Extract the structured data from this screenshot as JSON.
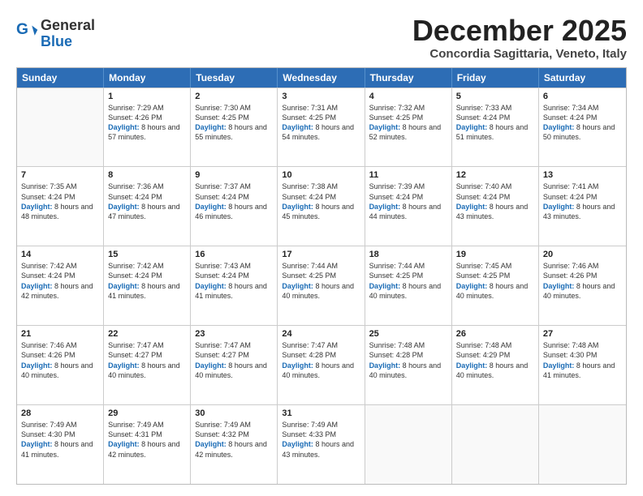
{
  "header": {
    "logo_general": "General",
    "logo_blue": "Blue",
    "month_title": "December 2025",
    "subtitle": "Concordia Sagittaria, Veneto, Italy"
  },
  "weekdays": [
    "Sunday",
    "Monday",
    "Tuesday",
    "Wednesday",
    "Thursday",
    "Friday",
    "Saturday"
  ],
  "rows": [
    [
      {
        "day": "",
        "sunrise": "",
        "sunset": "",
        "daylight": ""
      },
      {
        "day": "1",
        "sunrise": "Sunrise: 7:29 AM",
        "sunset": "Sunset: 4:26 PM",
        "daylight": "Daylight: 8 hours and 57 minutes."
      },
      {
        "day": "2",
        "sunrise": "Sunrise: 7:30 AM",
        "sunset": "Sunset: 4:25 PM",
        "daylight": "Daylight: 8 hours and 55 minutes."
      },
      {
        "day": "3",
        "sunrise": "Sunrise: 7:31 AM",
        "sunset": "Sunset: 4:25 PM",
        "daylight": "Daylight: 8 hours and 54 minutes."
      },
      {
        "day": "4",
        "sunrise": "Sunrise: 7:32 AM",
        "sunset": "Sunset: 4:25 PM",
        "daylight": "Daylight: 8 hours and 52 minutes."
      },
      {
        "day": "5",
        "sunrise": "Sunrise: 7:33 AM",
        "sunset": "Sunset: 4:24 PM",
        "daylight": "Daylight: 8 hours and 51 minutes."
      },
      {
        "day": "6",
        "sunrise": "Sunrise: 7:34 AM",
        "sunset": "Sunset: 4:24 PM",
        "daylight": "Daylight: 8 hours and 50 minutes."
      }
    ],
    [
      {
        "day": "7",
        "sunrise": "Sunrise: 7:35 AM",
        "sunset": "Sunset: 4:24 PM",
        "daylight": "Daylight: 8 hours and 48 minutes."
      },
      {
        "day": "8",
        "sunrise": "Sunrise: 7:36 AM",
        "sunset": "Sunset: 4:24 PM",
        "daylight": "Daylight: 8 hours and 47 minutes."
      },
      {
        "day": "9",
        "sunrise": "Sunrise: 7:37 AM",
        "sunset": "Sunset: 4:24 PM",
        "daylight": "Daylight: 8 hours and 46 minutes."
      },
      {
        "day": "10",
        "sunrise": "Sunrise: 7:38 AM",
        "sunset": "Sunset: 4:24 PM",
        "daylight": "Daylight: 8 hours and 45 minutes."
      },
      {
        "day": "11",
        "sunrise": "Sunrise: 7:39 AM",
        "sunset": "Sunset: 4:24 PM",
        "daylight": "Daylight: 8 hours and 44 minutes."
      },
      {
        "day": "12",
        "sunrise": "Sunrise: 7:40 AM",
        "sunset": "Sunset: 4:24 PM",
        "daylight": "Daylight: 8 hours and 43 minutes."
      },
      {
        "day": "13",
        "sunrise": "Sunrise: 7:41 AM",
        "sunset": "Sunset: 4:24 PM",
        "daylight": "Daylight: 8 hours and 43 minutes."
      }
    ],
    [
      {
        "day": "14",
        "sunrise": "Sunrise: 7:42 AM",
        "sunset": "Sunset: 4:24 PM",
        "daylight": "Daylight: 8 hours and 42 minutes."
      },
      {
        "day": "15",
        "sunrise": "Sunrise: 7:42 AM",
        "sunset": "Sunset: 4:24 PM",
        "daylight": "Daylight: 8 hours and 41 minutes."
      },
      {
        "day": "16",
        "sunrise": "Sunrise: 7:43 AM",
        "sunset": "Sunset: 4:24 PM",
        "daylight": "Daylight: 8 hours and 41 minutes."
      },
      {
        "day": "17",
        "sunrise": "Sunrise: 7:44 AM",
        "sunset": "Sunset: 4:25 PM",
        "daylight": "Daylight: 8 hours and 40 minutes."
      },
      {
        "day": "18",
        "sunrise": "Sunrise: 7:44 AM",
        "sunset": "Sunset: 4:25 PM",
        "daylight": "Daylight: 8 hours and 40 minutes."
      },
      {
        "day": "19",
        "sunrise": "Sunrise: 7:45 AM",
        "sunset": "Sunset: 4:25 PM",
        "daylight": "Daylight: 8 hours and 40 minutes."
      },
      {
        "day": "20",
        "sunrise": "Sunrise: 7:46 AM",
        "sunset": "Sunset: 4:26 PM",
        "daylight": "Daylight: 8 hours and 40 minutes."
      }
    ],
    [
      {
        "day": "21",
        "sunrise": "Sunrise: 7:46 AM",
        "sunset": "Sunset: 4:26 PM",
        "daylight": "Daylight: 8 hours and 40 minutes."
      },
      {
        "day": "22",
        "sunrise": "Sunrise: 7:47 AM",
        "sunset": "Sunset: 4:27 PM",
        "daylight": "Daylight: 8 hours and 40 minutes."
      },
      {
        "day": "23",
        "sunrise": "Sunrise: 7:47 AM",
        "sunset": "Sunset: 4:27 PM",
        "daylight": "Daylight: 8 hours and 40 minutes."
      },
      {
        "day": "24",
        "sunrise": "Sunrise: 7:47 AM",
        "sunset": "Sunset: 4:28 PM",
        "daylight": "Daylight: 8 hours and 40 minutes."
      },
      {
        "day": "25",
        "sunrise": "Sunrise: 7:48 AM",
        "sunset": "Sunset: 4:28 PM",
        "daylight": "Daylight: 8 hours and 40 minutes."
      },
      {
        "day": "26",
        "sunrise": "Sunrise: 7:48 AM",
        "sunset": "Sunset: 4:29 PM",
        "daylight": "Daylight: 8 hours and 40 minutes."
      },
      {
        "day": "27",
        "sunrise": "Sunrise: 7:48 AM",
        "sunset": "Sunset: 4:30 PM",
        "daylight": "Daylight: 8 hours and 41 minutes."
      }
    ],
    [
      {
        "day": "28",
        "sunrise": "Sunrise: 7:49 AM",
        "sunset": "Sunset: 4:30 PM",
        "daylight": "Daylight: 8 hours and 41 minutes."
      },
      {
        "day": "29",
        "sunrise": "Sunrise: 7:49 AM",
        "sunset": "Sunset: 4:31 PM",
        "daylight": "Daylight: 8 hours and 42 minutes."
      },
      {
        "day": "30",
        "sunrise": "Sunrise: 7:49 AM",
        "sunset": "Sunset: 4:32 PM",
        "daylight": "Daylight: 8 hours and 42 minutes."
      },
      {
        "day": "31",
        "sunrise": "Sunrise: 7:49 AM",
        "sunset": "Sunset: 4:33 PM",
        "daylight": "Daylight: 8 hours and 43 minutes."
      },
      {
        "day": "",
        "sunrise": "",
        "sunset": "",
        "daylight": ""
      },
      {
        "day": "",
        "sunrise": "",
        "sunset": "",
        "daylight": ""
      },
      {
        "day": "",
        "sunrise": "",
        "sunset": "",
        "daylight": ""
      }
    ]
  ]
}
